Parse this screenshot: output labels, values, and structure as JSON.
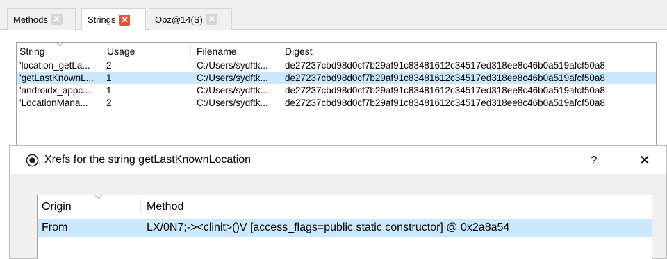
{
  "tabs": [
    {
      "label": "Methods",
      "active": false
    },
    {
      "label": "Strings",
      "active": true
    },
    {
      "label": "Opz@14(S)",
      "active": false
    }
  ],
  "tab_close_glyph": "✕",
  "strings_table": {
    "columns": [
      "String",
      "Usage",
      "Filename",
      "Digest"
    ],
    "rows": [
      {
        "string": "'location_getLa...",
        "usage": "2",
        "filename": "C:/Users/sydftk...",
        "digest": "de27237cbd98d0cf7b29af91c83481612c34517ed318ee8c46b0a519afcf50a8",
        "selected": false
      },
      {
        "string": "'getLastKnownL...",
        "usage": "1",
        "filename": "C:/Users/sydftk...",
        "digest": "de27237cbd98d0cf7b29af91c83481612c34517ed318ee8c46b0a519afcf50a8",
        "selected": true
      },
      {
        "string": "'androidx_appc...",
        "usage": "1",
        "filename": "C:/Users/sydftk...",
        "digest": "de27237cbd98d0cf7b29af91c83481612c34517ed318ee8c46b0a519afcf50a8",
        "selected": false
      },
      {
        "string": "'LocationMana...",
        "usage": "2",
        "filename": "C:/Users/sydftk...",
        "digest": "de27237cbd98d0cf7b29af91c83481612c34517ed318ee8c46b0a519afcf50a8",
        "selected": false
      }
    ]
  },
  "dialog": {
    "title": "Xrefs for the string getLastKnownLocation",
    "help_glyph": "?",
    "close_glyph": "✕",
    "icon": "radio-target-icon",
    "columns": [
      "Origin",
      "Method"
    ],
    "rows": [
      {
        "origin": "From",
        "method": "LX/0N7;-><clinit>()V [access_flags=public static constructor] @ 0x2a8a54",
        "selected": true
      }
    ]
  },
  "colors": {
    "selection": "#cce8ff",
    "active_tab_close": "#e8503a",
    "inactive_tab_close": "#d6d6d6",
    "chrome": "#f0f0f0"
  }
}
